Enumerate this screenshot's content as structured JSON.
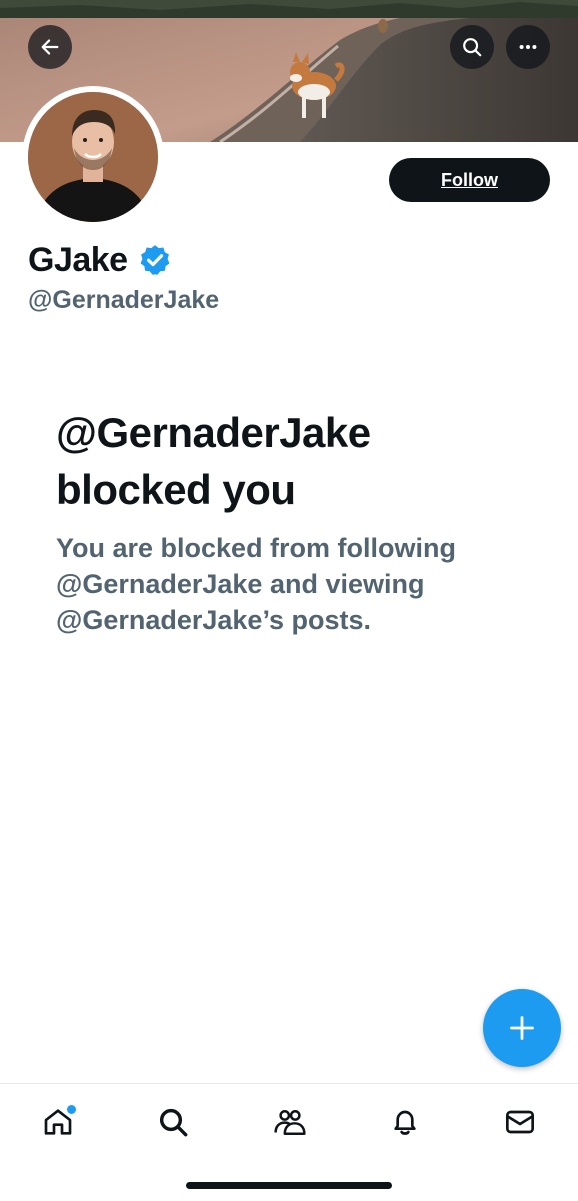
{
  "profile": {
    "display_name": "GJake",
    "handle": "@GernaderJake",
    "verified_icon": "verified-badge-icon"
  },
  "actions": {
    "follow_label": "Follow"
  },
  "blocked": {
    "title": "@GernaderJake blocked you",
    "message": "You are blocked from following @GernaderJake and viewing @GernaderJake’s posts."
  },
  "header_buttons": {
    "back_icon": "arrow-left-icon",
    "search_icon": "search-icon",
    "more_icon": "more-horizontal-icon"
  },
  "fab": {
    "icon": "plus-icon"
  },
  "nav": {
    "items": [
      {
        "icon": "home-icon",
        "has_notification_dot": true
      },
      {
        "icon": "search-icon"
      },
      {
        "icon": "communities-icon"
      },
      {
        "icon": "bell-icon"
      },
      {
        "icon": "mail-icon"
      }
    ]
  },
  "colors": {
    "accent": "#1d9bf0",
    "text_primary": "#0f1419",
    "text_secondary": "#536471",
    "button_dark": "#0f1419"
  }
}
